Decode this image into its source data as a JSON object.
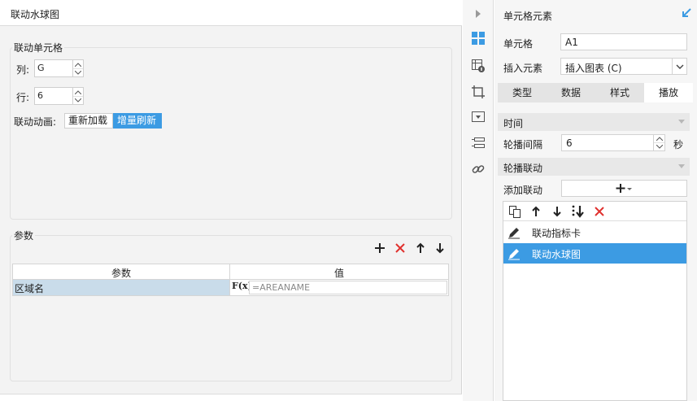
{
  "left_dialog": {
    "title": "联动水球图",
    "linked_cell": {
      "group_title": "联动单元格",
      "col_label": "列:",
      "col_value": "G",
      "row_label": "行:",
      "row_value": "6",
      "anim_label": "联动动画:",
      "anim_options": [
        "重新加载",
        "增量刷新"
      ],
      "anim_selected": "增量刷新"
    },
    "params": {
      "group_title": "参数",
      "tools": [
        "add-icon",
        "delete-icon",
        "move-up-icon",
        "move-down-icon"
      ],
      "columns": [
        "参数",
        "值"
      ],
      "rows": [
        {
          "name": "区域名",
          "value": "=AREANAME"
        }
      ],
      "fx_label": "F(x)"
    }
  },
  "icon_strip": [
    "expand-arrow-icon",
    "cell-element-icon",
    "cell-attribute-icon",
    "float-element-icon",
    "widget-settings-icon",
    "condition-attribute-icon",
    "hyperlink-icon"
  ],
  "right_panel": {
    "title": "单元格元素",
    "cell_label": "单元格",
    "cell_value": "A1",
    "insert_label": "插入元素",
    "insert_value": "插入图表 (C)",
    "tabs": [
      "类型",
      "数据",
      "样式",
      "播放"
    ],
    "active_tab": "播放",
    "time_section": "时间",
    "interval_label": "轮播间隔",
    "interval_value": "6",
    "interval_unit": "秒",
    "carousel_section": "轮播联动",
    "add_link_label": "添加联动",
    "list_items": [
      {
        "name": "联动指标卡",
        "selected": false
      },
      {
        "name": "联动水球图",
        "selected": true
      }
    ],
    "accent": "#3c9be3",
    "delete_color": "#e0312e"
  }
}
